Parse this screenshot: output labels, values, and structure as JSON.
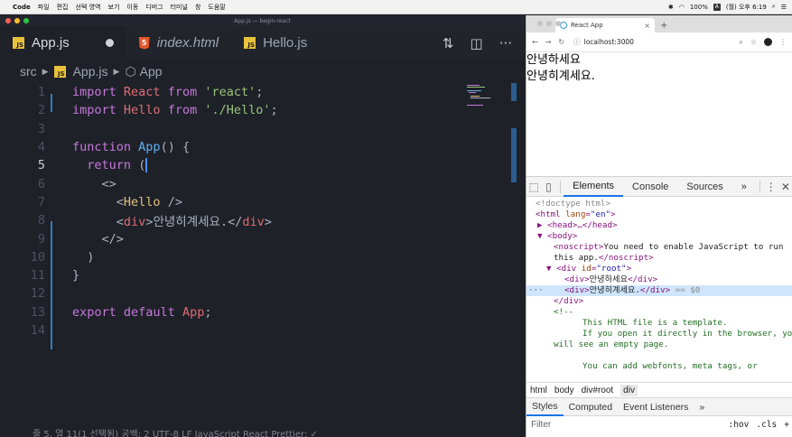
{
  "menubar": {
    "items": [
      "Code",
      "파일",
      "편집",
      "선택 영역",
      "보기",
      "이동",
      "디버그",
      "터미널",
      "창",
      "도움말"
    ],
    "battery": "100%",
    "clock": "(월) 오후 6:19"
  },
  "vscode": {
    "window_title": "App.js — begin-react",
    "tabs": [
      {
        "label": "App.js",
        "type": "js",
        "active": true,
        "modified": true
      },
      {
        "label": "index.html",
        "type": "html",
        "active": false
      },
      {
        "label": "Hello.js",
        "type": "js",
        "active": false
      }
    ],
    "breadcrumb": {
      "folder": "src",
      "file": "App.js",
      "symbol": "App"
    },
    "line_numbers": [
      "1",
      "2",
      "3",
      "4",
      "5",
      "6",
      "7",
      "8",
      "9",
      "10",
      "11",
      "12",
      "13",
      "14"
    ],
    "current_line": "5",
    "code": {
      "l1": {
        "kw1": "import",
        "id": "React",
        "kw2": "from",
        "str": "'react'",
        "end": ";"
      },
      "l2": {
        "kw1": "import",
        "id": "Hello",
        "kw2": "from",
        "str": "'./Hello'",
        "end": ";"
      },
      "l4": {
        "kw": "function",
        "fn": "App",
        "rest": "() {"
      },
      "l5": {
        "kw": "return",
        "rest": "("
      },
      "l6": {
        "frag_open": "<>"
      },
      "l7": {
        "lt": "<",
        "tag": "Hello",
        "end": " />"
      },
      "l8": {
        "open": "<",
        "tag": "div",
        "close_br": ">",
        "text": "안녕히계세요.",
        "end_open": "</",
        "end_tag": "div",
        "end_br": ">"
      },
      "l9": {
        "frag_close": "</>"
      },
      "l10": {
        "paren": ")"
      },
      "l11": {
        "brace": "}"
      },
      "l13": {
        "kw1": "export",
        "kw2": "default",
        "id": "App",
        "end": ";"
      }
    },
    "status_text": "줄 5, 열 11(1 선택됨)    공백: 2    UTF-8    LF    JavaScript React    Prettier: ✓"
  },
  "chrome": {
    "tab_title": "React App",
    "url": "localhost:3000",
    "page_lines": [
      "안녕하세요",
      "안녕히계세요."
    ],
    "devtools": {
      "tabs": [
        "Elements",
        "Console",
        "Sources"
      ],
      "more": "»",
      "dom": {
        "doctype": "<!doctype html>",
        "html_open": "<html",
        "html_attr": "lang",
        "html_val": "\"en\"",
        "head": "<head>…</head>",
        "body": "<body>",
        "noscript_open": "<noscript>",
        "noscript_text1": "You need to enable JavaScript to run",
        "noscript_text2": "this app.",
        "noscript_close": "</noscript>",
        "div_open": "<div",
        "div_attr": "id",
        "div_val": "\"root\"",
        "child1_open": "<div>",
        "child1_text": "안녕하세요",
        "child1_close": "</div>",
        "child2_text": "안녕히계세요.",
        "selected_marker": "== $0",
        "div_close": "</div>",
        "comment_open": "<!--",
        "comment1": "This HTML file is a template.",
        "comment2": "If you open it directly in the browser, you",
        "comment3": "will see an empty page.",
        "comment4": "You can add webfonts, meta tags, or"
      },
      "crumbs": [
        "html",
        "body",
        "div#root",
        "div"
      ],
      "styles_tabs": [
        "Styles",
        "Computed",
        "Event Listeners"
      ],
      "filter_placeholder": "Filter",
      "hov": ":hov",
      "cls": ".cls",
      "plus": "+"
    }
  }
}
